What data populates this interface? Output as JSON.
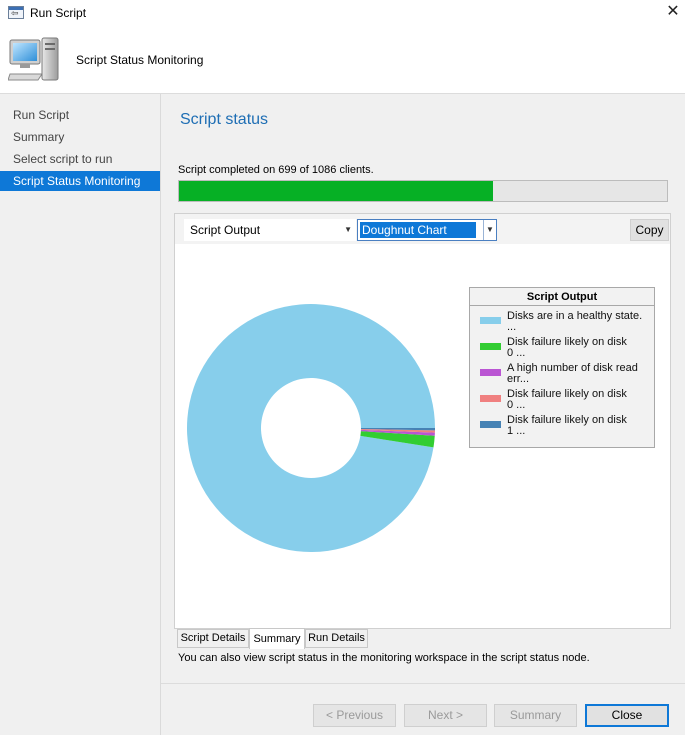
{
  "window": {
    "title": "Run Script",
    "close_glyph": "✕",
    "app_icon": "run-script-icon"
  },
  "header": {
    "title": "Script Status Monitoring",
    "icon": "computer-icon"
  },
  "sidebar": {
    "items": [
      {
        "label": "Run Script",
        "active": false
      },
      {
        "label": "Summary",
        "active": false
      },
      {
        "label": "Select script to run",
        "active": false
      },
      {
        "label": "Script Status Monitoring",
        "active": true
      }
    ]
  },
  "main": {
    "title": "Script status",
    "status_text": "Script completed on 699 of 1086 clients.",
    "progress": {
      "completed": 699,
      "total": 1086,
      "fill_color": "#06b025"
    },
    "toolbar": {
      "output_select": "Script Output",
      "chart_type_select": "Doughnut Chart",
      "copy_label": "Copy"
    },
    "tabs": [
      {
        "label": "Script Details",
        "active": false
      },
      {
        "label": "Summary",
        "active": true
      },
      {
        "label": "Run Details",
        "active": false
      }
    ],
    "note": "You can also view script status in the monitoring workspace in the script status node."
  },
  "chart_data": {
    "type": "pie",
    "variant": "doughnut",
    "legend_title": "Script Output",
    "legend_position": "top-right",
    "series": [
      {
        "name": "Disks are in a healthy state. ...",
        "value": 0.975,
        "color": "#87ceeb",
        "legend_lines": [
          "Disks are in a healthy state.",
          "..."
        ]
      },
      {
        "name": "Disk failure likely on disk 0 ...",
        "value": 0.015,
        "color": "#32cd32",
        "legend_lines": [
          "Disk failure likely on disk",
          "0 ..."
        ]
      },
      {
        "name": "A high number of disk read err...",
        "value": 0.004,
        "color": "#ba55d3",
        "legend_lines": [
          "A high number of disk read",
          "err..."
        ]
      },
      {
        "name": "Disk failure likely on disk 0 ...",
        "value": 0.003,
        "color": "#f08080",
        "legend_lines": [
          "Disk failure likely on disk",
          "0 ..."
        ]
      },
      {
        "name": "Disk failure likely on disk 1 ...",
        "value": 0.003,
        "color": "#4682b4",
        "legend_lines": [
          "Disk failure likely on disk",
          "1 ..."
        ]
      }
    ]
  },
  "footer": {
    "previous": "< Previous",
    "next": "Next >",
    "summary": "Summary",
    "close": "Close",
    "primary_color": "#0e78d7"
  }
}
